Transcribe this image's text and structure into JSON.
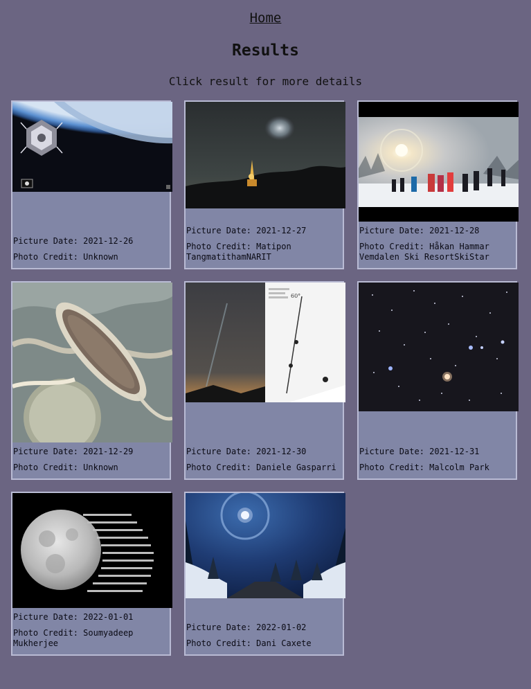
{
  "nav": {
    "home_label": "Home"
  },
  "header": {
    "title": "Results",
    "subtitle": "Click result for more details"
  },
  "results": [
    {
      "date_label": "Picture Date: 2021-12-26",
      "credit_label": "Photo Credit: Unknown",
      "icon": "space-telescope-over-earth-image"
    },
    {
      "date_label": "Picture Date: 2021-12-27",
      "credit_label": "Photo Credit: Matipon TangmatithamNARIT",
      "icon": "comet-over-temple-image"
    },
    {
      "date_label": "Picture Date: 2021-12-28",
      "credit_label": "Photo Credit: Håkan Hammar Vemdalen Ski ResortSkiStar",
      "icon": "sun-halo-ski-slope-image"
    },
    {
      "date_label": "Picture Date: 2021-12-29",
      "credit_label": "Photo Credit: Unknown",
      "icon": "jupiter-storm-image"
    },
    {
      "date_label": "Picture Date: 2021-12-30",
      "credit_label": "Photo Credit: Daniele Gasparri",
      "icon": "comet-tail-comparison-image"
    },
    {
      "date_label": "Picture Date: 2021-12-31",
      "credit_label": "Photo Credit: Malcolm Park",
      "icon": "star-field-image"
    },
    {
      "date_label": "Picture Date: 2022-01-01",
      "credit_label": "Photo Credit: Soumyadeep Mukherjee",
      "icon": "full-moons-chart-image"
    },
    {
      "date_label": "Picture Date: 2022-01-02",
      "credit_label": "Photo Credit: Dani Caxete",
      "icon": "moon-halo-forest-road-image"
    }
  ]
}
